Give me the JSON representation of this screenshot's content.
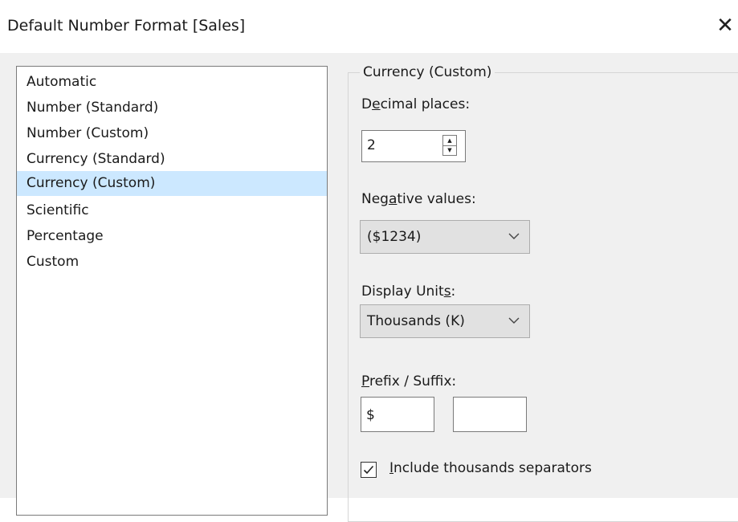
{
  "dialog": {
    "title": "Default Number Format [Sales]",
    "close_glyph": "✕"
  },
  "format_list": {
    "items": [
      {
        "label": "Automatic",
        "selected": false
      },
      {
        "label": "Number (Standard)",
        "selected": false
      },
      {
        "label": "Number (Custom)",
        "selected": false
      },
      {
        "label": "Currency (Standard)",
        "selected": false
      },
      {
        "label": "Currency (Custom)",
        "selected": true
      },
      {
        "label": "Scientific",
        "selected": false
      },
      {
        "label": "Percentage",
        "selected": false
      },
      {
        "label": "Custom",
        "selected": false
      }
    ]
  },
  "options": {
    "group_title": "Currency (Custom)",
    "decimal_places": {
      "label_pre": "D",
      "label_mnemonic": "e",
      "label_post": "cimal places:",
      "value": "2",
      "up_glyph": "▲",
      "down_glyph": "▼"
    },
    "negative_values": {
      "label_pre": "Neg",
      "label_mnemonic": "a",
      "label_post": "tive values:",
      "selected": "($1234)"
    },
    "display_units": {
      "label_pre": "Display Unit",
      "label_mnemonic": "s",
      "label_post": ":",
      "selected": "Thousands (K)"
    },
    "prefix_suffix": {
      "label_mnemonic": "P",
      "label_post": "refix / Suffix:",
      "prefix_value": "$",
      "suffix_value": ""
    },
    "thousands_separators": {
      "label_mnemonic": "I",
      "label_post": "nclude thousands separators",
      "checked": true
    }
  },
  "colors": {
    "selection": "#cce8ff",
    "client_background": "#f0f0f0",
    "combo_background": "#e1e1e1"
  },
  "icons": {
    "close": "close-icon",
    "spin_up": "spin-up-icon",
    "spin_down": "spin-down-icon",
    "dropdown": "chevron-down-icon",
    "check": "checkmark-icon"
  }
}
